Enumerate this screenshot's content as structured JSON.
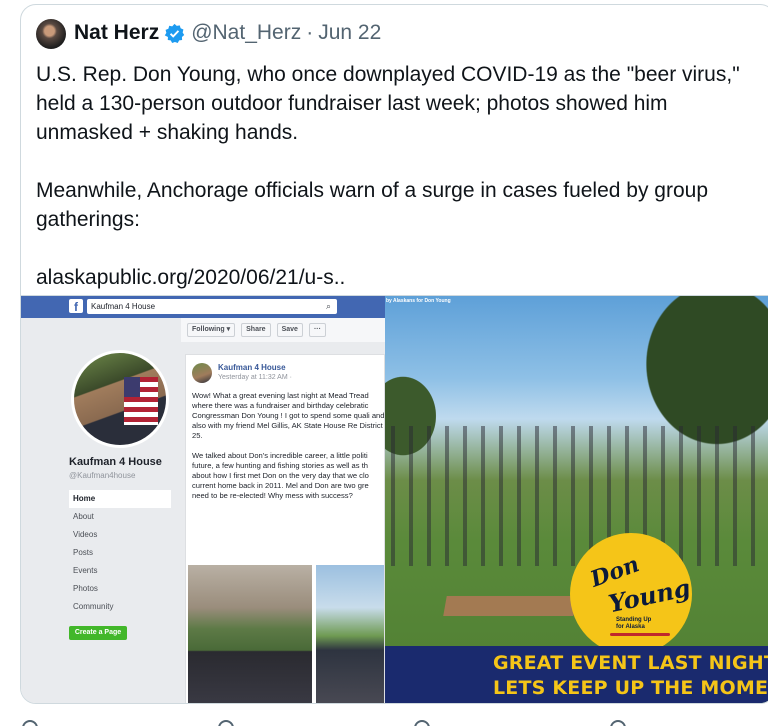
{
  "tweet": {
    "author_name": "Nat Herz",
    "handle": "@Nat_Herz",
    "separator": "·",
    "date": "Jun 22",
    "verified_color": "#1d9bf0",
    "text_line1": "U.S. Rep. Don Young, who once downplayed COVID-19 as the \"beer virus,\" held a 130-person outdoor fundraiser last week; photos showed him unmasked + shaking hands.",
    "text_line2": "Meanwhile, Anchorage officials warn of a surge in cases fueled by group gatherings:",
    "link": "alaskapublic.org/2020/06/21/u-s.."
  },
  "fb": {
    "search_value": "Kaufman 4 House",
    "search_icon": "search-icon",
    "page_name": "Kaufman 4 House",
    "page_handle": "@Kaufman4house",
    "nav": [
      "Home",
      "About",
      "Videos",
      "Posts",
      "Events",
      "Photos",
      "Community"
    ],
    "create_page": "Create a Page",
    "toolbar": {
      "following": "Following ▾",
      "share": "Share",
      "save": "Save",
      "more": "···"
    },
    "post": {
      "author": "Kaufman 4 House",
      "time": "Yesterday at 11:32 AM · ",
      "body": "Wow! What a great evening last night at Mead Tread where there was a fundraiser and birthday celebratic Congressman Don Young ! I got to spend some quali and also with my friend Mel Gillis, AK State House Re District 25.\n\nWe talked about Don's incredible career, a little politi future, a few hunting and fishing stories as well as th about how I first met Don on the very day that we clo current home back in 2011. Mel and Don are two gre need to be re-elected! Why mess with success?"
    }
  },
  "photo": {
    "caption": "by Alaskans for Don Young",
    "logo_don": "Don",
    "logo_young": "Young",
    "logo_tagline": "Standing Up for Alaska",
    "banner_line1": "GREAT EVENT LAST NIGHT",
    "banner_line2": "LETS KEEP UP THE MOMENTU"
  }
}
